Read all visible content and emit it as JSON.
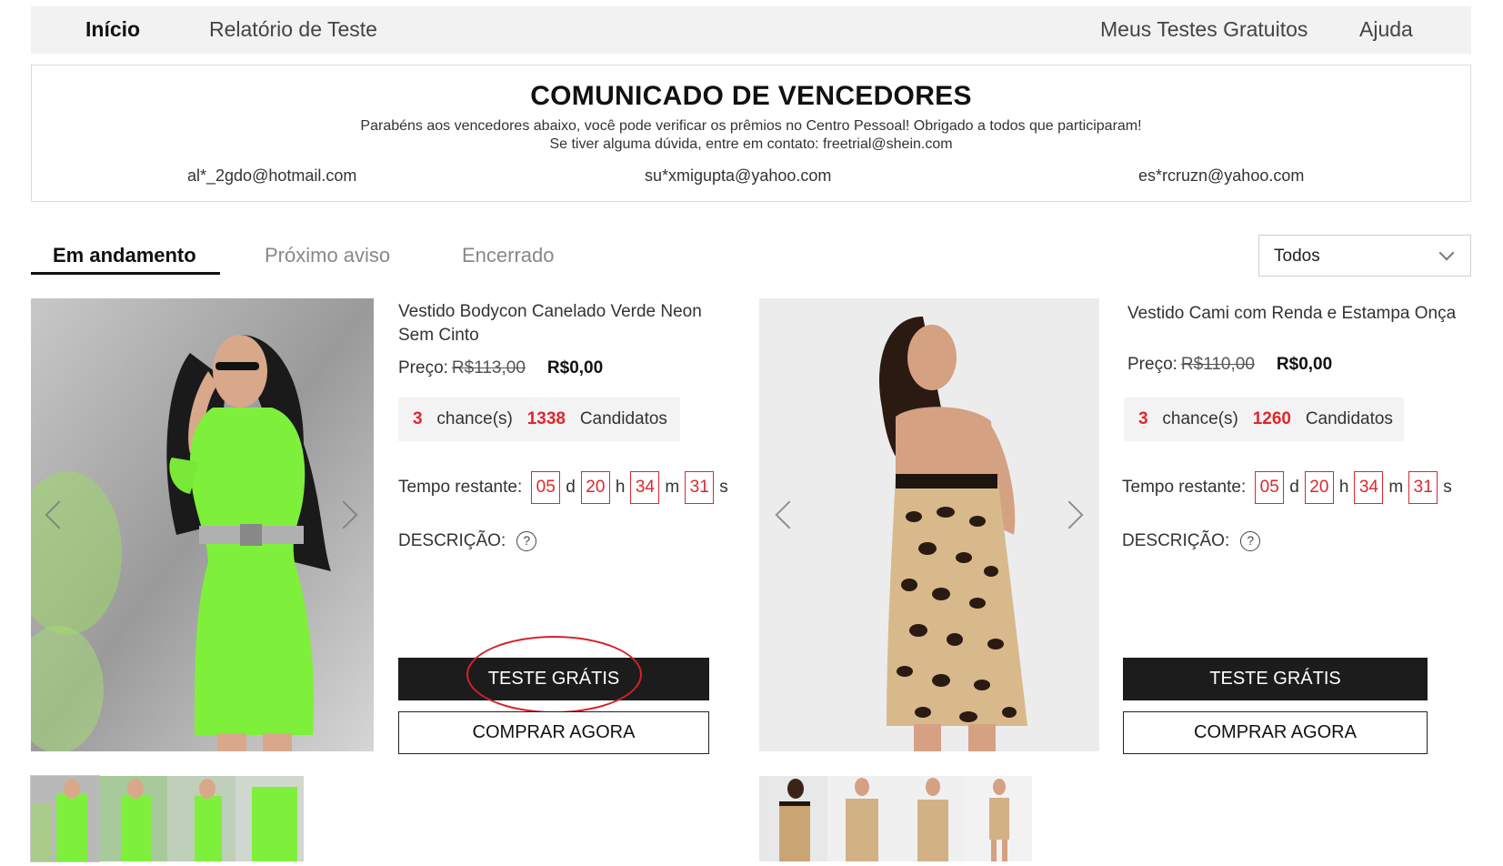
{
  "nav": {
    "home": "Início",
    "report": "Relatório de Teste",
    "my_tests": "Meus Testes Gratuitos",
    "help": "Ajuda"
  },
  "announcement": {
    "title": "COMUNICADO DE VENCEDORES",
    "line1": "Parabéns aos vencedores abaixo, você pode verificar os prêmios no Centro Pessoal! Obrigado a todos que participaram!",
    "line2": "Se tiver alguma dúvida, entre em contato: freetrial@shein.com",
    "winners": [
      "al*_2gdo@hotmail.com",
      "su*xmigupta@yahoo.com",
      "es*rcruzn@yahoo.com"
    ]
  },
  "tabs": {
    "ongoing": "Em andamento",
    "upcoming": "Próximo aviso",
    "closed": "Encerrado"
  },
  "filter": {
    "selected": "Todos"
  },
  "common": {
    "price_label": "Preço:",
    "chances_label": "chance(s)",
    "candidates_label": "Candidatos",
    "time_label": "Tempo restante:",
    "unit_d": "d",
    "unit_h": "h",
    "unit_m": "m",
    "unit_s": "s",
    "desc_label": "DESCRIÇÃO:",
    "question_mark": "?",
    "trial_button": "TESTE GRÁTIS",
    "buy_button": "COMPRAR AGORA"
  },
  "products": [
    {
      "name": "Vestido Bodycon Canelado Verde Neon Sem Cinto",
      "old_price": "R$113,00",
      "new_price": "R$0,00",
      "chances": "3",
      "candidates": "1338",
      "days": "05",
      "hours": "20",
      "minutes": "34",
      "seconds": "31"
    },
    {
      "name": "Vestido Cami com Renda e Estampa Onça",
      "old_price": "R$110,00",
      "new_price": "R$0,00",
      "chances": "3",
      "candidates": "1260",
      "days": "05",
      "hours": "20",
      "minutes": "34",
      "seconds": "31"
    }
  ],
  "colors": {
    "accent_red": "#e0262d",
    "button_dark": "#1c1c1c",
    "nav_bg": "#f2f2f2"
  }
}
